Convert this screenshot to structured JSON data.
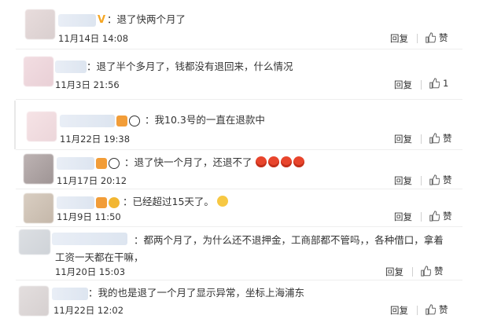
{
  "comments": [
    {
      "text": "：退了快两个月了",
      "time": "11月14日 14:08",
      "reply": "回复",
      "like": "赞"
    },
    {
      "text": "：退了半个多月了，钱都没有退回来，什么情况",
      "time": "11月3日 21:56",
      "reply": "回复",
      "like": "1"
    },
    {
      "text": "：我10.3号的一直在退款中",
      "time": "11月22日 19:38",
      "reply": "回复",
      "like": "赞"
    },
    {
      "text": "：退了快一个月了，还退不了",
      "time": "11月17日 20:12",
      "reply": "回复",
      "like": "赞"
    },
    {
      "text": "：已经超过15天了。",
      "time": "11月9日 11:50",
      "reply": "回复",
      "like": "赞"
    },
    {
      "text": "：都两个月了，为什么还不退押金，工商部都不管吗，，各种借口，拿着工资一天都在干嘛，",
      "time": "11月20日 15:03",
      "reply": "回复",
      "like": "赞"
    },
    {
      "text": "：我的也是退了一个月了显示异常，坐标上海浦东",
      "time": "11月22日 12:02",
      "reply": "回复",
      "like": "赞"
    }
  ],
  "badge_v": "V",
  "colors": {
    "accent": "#f5a623",
    "text": "#333333",
    "divider": "#eeeeee"
  },
  "icons": [
    "thumb-up-icon",
    "panda-emoji-icon",
    "angry-emoji-icon",
    "laugh-emoji-icon",
    "vip-badge-icon"
  ]
}
